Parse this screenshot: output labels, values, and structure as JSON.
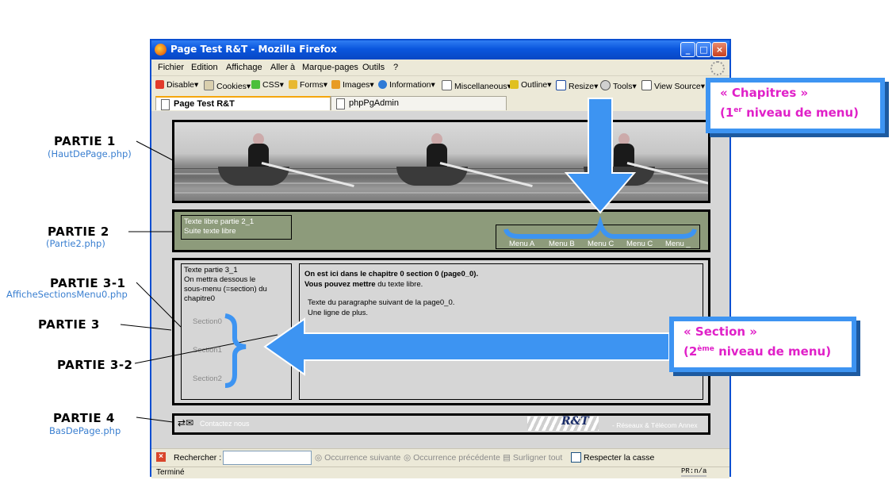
{
  "window": {
    "title": "Page Test R&T - Mozilla Firefox",
    "controls": [
      "_",
      "□",
      "×"
    ]
  },
  "menubar": [
    "Fichier",
    "Edition",
    "Affichage",
    "Aller à",
    "Marque-pages",
    "Outils",
    "?"
  ],
  "toolbar": [
    "Disable▾",
    "Cookies▾",
    "CSS▾",
    "Forms▾",
    "Images▾",
    "Information▾",
    "Miscellaneous▾",
    "Outline▾",
    "Resize▾",
    "Tools▾",
    "View Source▾"
  ],
  "tabs": [
    {
      "label": "Page Test R&T",
      "active": true
    },
    {
      "label": "phpPgAdmin",
      "active": false
    }
  ],
  "page": {
    "partie2": {
      "line1": "Texte libre partie 2_1",
      "line2": "Suite texte libre",
      "menu": [
        "Menu A",
        "Menu B",
        "Menu C",
        "Menu C",
        "Menu _"
      ]
    },
    "partie3_1": {
      "lines": [
        "Texte partie 3_1",
        "On mettra dessous le",
        "sous-menu (=section) du",
        "chapitre0"
      ],
      "sections": [
        "Section0",
        "Section1",
        "Section2"
      ]
    },
    "partie3_2": {
      "bold1": "On est ici dans le chapitre 0 section 0 (page0_0).",
      "bold2": "Vous pouvez mettre",
      "normal2": " du texte libre.",
      "para1": "Texte du paragraphe suivant de la page0_0.",
      "para2": "Une ligne de plus."
    },
    "partie4": {
      "contact": "Contactez nous",
      "logo": "R&T",
      "network": "- Réseaux & Télécom Annex"
    }
  },
  "findbar": {
    "label": "Rechercher :",
    "next": "Occurrence suivante",
    "prev": "Occurrence précédente",
    "highlight": "Surligner tout",
    "case": "Respecter la casse"
  },
  "status": {
    "text": "Terminé",
    "pr": "PR:n/a"
  },
  "annotations": {
    "p1": "PARTIE 1",
    "p1_sub": "(HautDePage.php)",
    "p2": "PARTIE 2",
    "p2_sub": "(Partie2.php)",
    "p31": "PARTIE 3-1",
    "p31_sub": "AfficheSectionsMenu0.php",
    "p3": "PARTIE 3",
    "p32": "PARTIE 3-2",
    "p4": "PARTIE 4",
    "p4_sub": "BasDePage.php",
    "chapitres_l1": "« Chapitres »",
    "chapitres_l2a": "(1",
    "chapitres_sup": "er",
    "chapitres_l2b": " niveau de menu)",
    "section_l1": "« Section »",
    "section_l2a": "(2",
    "section_sup": "ème",
    "section_l2b": " niveau de menu)"
  },
  "colors": {
    "titlebar": "#0a56dd",
    "partie2_bg": "#8d9b7b",
    "callout_border": "#3d94f2",
    "callout_text": "#e020c8",
    "annotation_sub": "#3a7fd0"
  }
}
